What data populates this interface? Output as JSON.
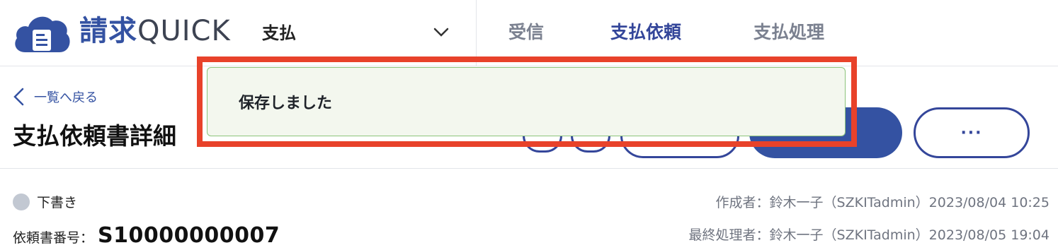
{
  "app": {
    "logo_jp": "請求",
    "logo_en": "QUICK",
    "brand_color": "#3452a2",
    "logo_icon": "cloud-document-icon"
  },
  "header": {
    "module_label": "支払",
    "module_chevron": "chevron-down-icon",
    "tabs": [
      {
        "label": "受信",
        "active": false
      },
      {
        "label": "支払依頼",
        "active": true
      },
      {
        "label": "支払処理",
        "active": false
      }
    ]
  },
  "page": {
    "back_label": "一覧へ戻る",
    "title": "支払依頼書詳細",
    "more_label": "···"
  },
  "document": {
    "status": "下書き",
    "number_label": "依頼書番号：",
    "number": "S10000000007",
    "created": "作成者：鈴木一子（SZKITadmin）2023/08/04 10:25",
    "updated": "最終処理者：鈴木一子（SZKITadmin）2023/08/05 19:04"
  },
  "toast": {
    "message": "保存しました",
    "highlight_color": "#e8422a"
  }
}
